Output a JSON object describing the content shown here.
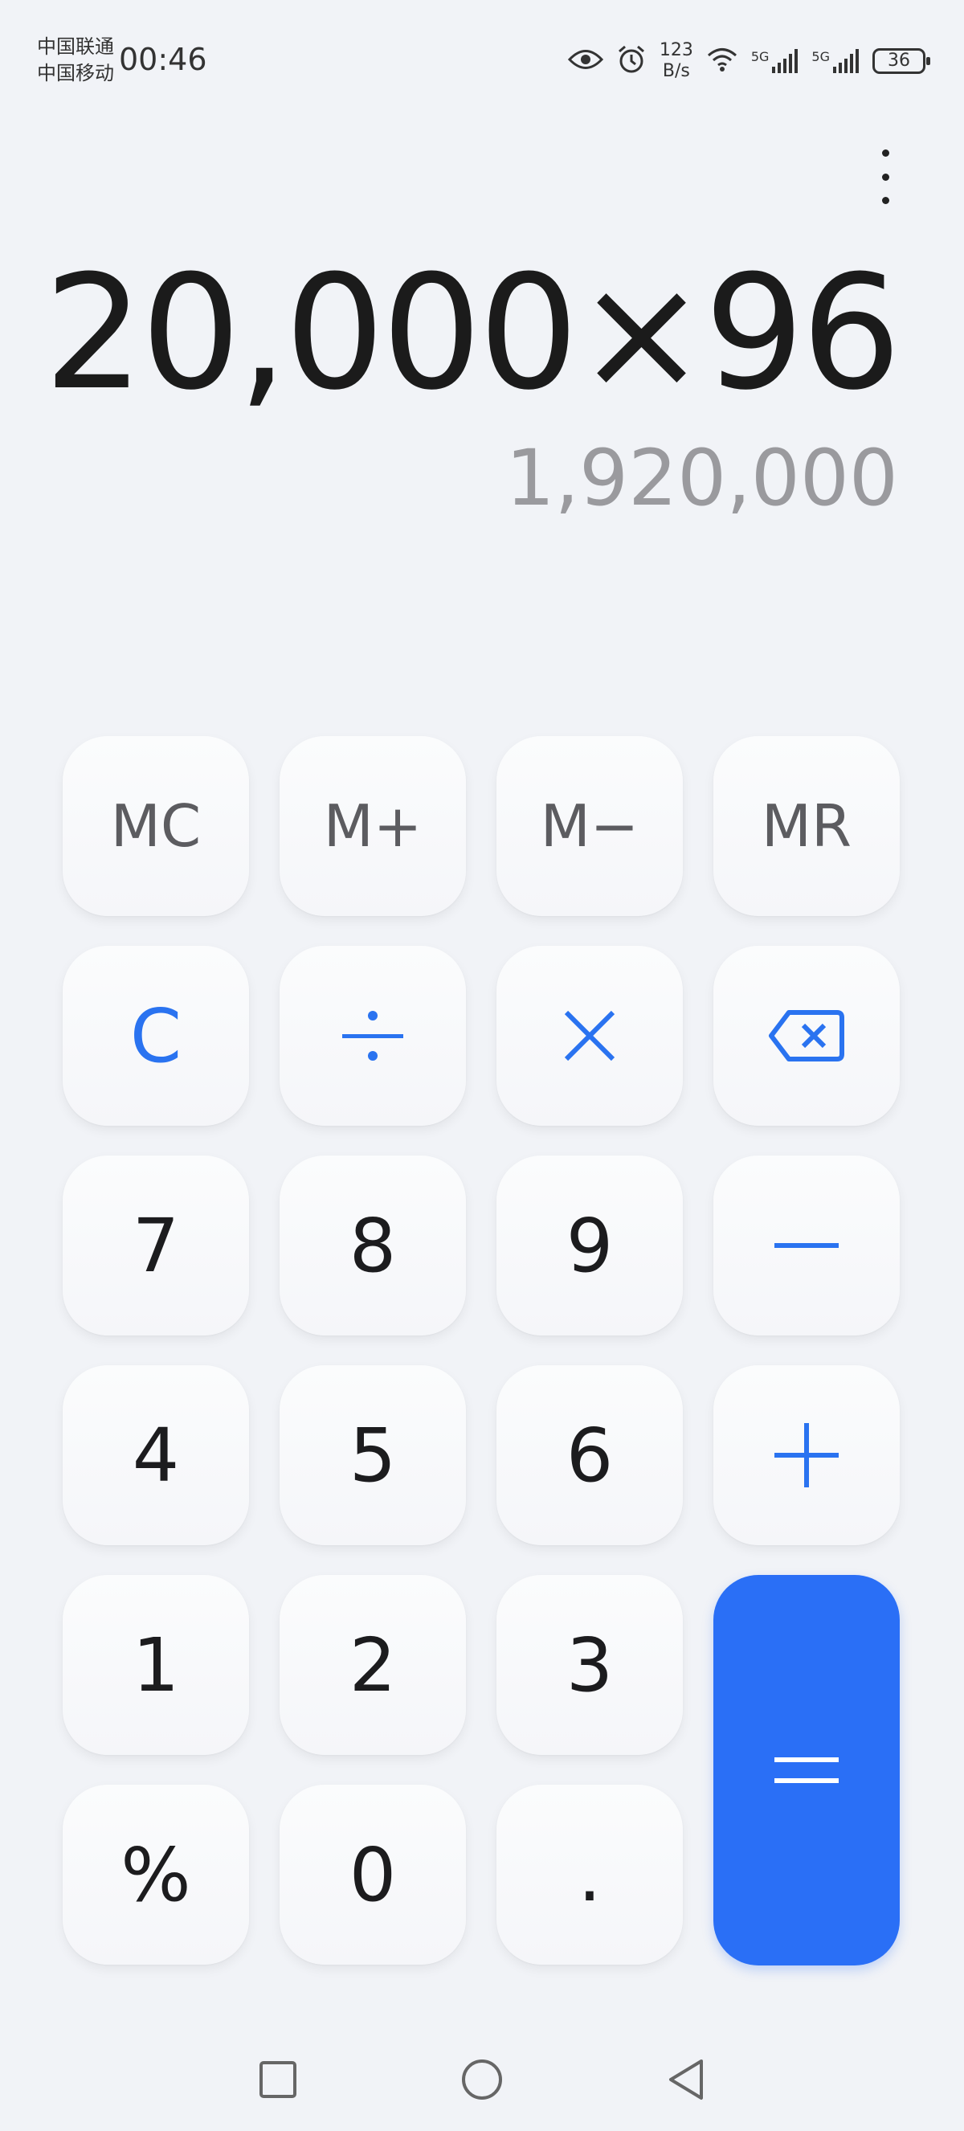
{
  "status_bar": {
    "carrier_1": "中国联通",
    "carrier_2": "中国移动",
    "time": "00:46",
    "speed_value": "123",
    "speed_unit": "B/s",
    "network_1": "5G",
    "network_2": "5G",
    "battery": "36"
  },
  "display": {
    "expression": "20,000×96",
    "result": "1,920,000"
  },
  "keys": {
    "mc": "MC",
    "m_plus": "M+",
    "m_minus": "M−",
    "mr": "MR",
    "clear": "C",
    "d7": "7",
    "d8": "8",
    "d9": "9",
    "d4": "4",
    "d5": "5",
    "d6": "6",
    "d1": "1",
    "d2": "2",
    "d3": "3",
    "percent": "%",
    "d0": "0",
    "dot": "."
  },
  "colors": {
    "accent": "#2a73f0",
    "equals_bg": "#2a6ff6",
    "background": "#f1f3f7"
  },
  "icons": [
    "eye-icon",
    "alarm-icon",
    "wifi-icon",
    "signal-icon",
    "battery-icon",
    "more-vertical-icon",
    "divide-icon",
    "multiply-icon",
    "backspace-icon",
    "minus-icon",
    "plus-icon",
    "equals-icon",
    "square-nav-icon",
    "circle-nav-icon",
    "back-nav-icon"
  ]
}
